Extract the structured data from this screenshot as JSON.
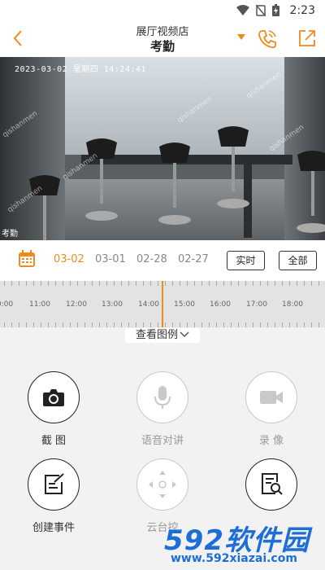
{
  "status_bar": {
    "time": "2:23"
  },
  "header": {
    "store_name": "展厅视频店",
    "camera_name": "考勤"
  },
  "video": {
    "osd_text": "2023-03-02 星期四 14:24:41",
    "watermark": "qishanmen",
    "camera_label": "考勤"
  },
  "date_bar": {
    "dates": [
      "03-02",
      "03-01",
      "02-28",
      "02-27"
    ],
    "selected_date": "03-02",
    "live_button": "实时",
    "all_button": "全部"
  },
  "timeline": {
    "labels": [
      "0:00",
      "11:00",
      "12:00",
      "13:00",
      "14:00",
      "15:00",
      "16:00",
      "17:00",
      "18:00"
    ]
  },
  "legend_label": "查看图例",
  "functions": [
    {
      "label": "截 图",
      "icon": "camera-icon",
      "enabled": true
    },
    {
      "label": "语音对讲",
      "icon": "microphone-icon",
      "enabled": false
    },
    {
      "label": "录 像",
      "icon": "video-record-icon",
      "enabled": false
    },
    {
      "label": "创建事件",
      "icon": "edit-icon",
      "enabled": true
    },
    {
      "label": "云台控",
      "icon": "ptz-control-icon",
      "enabled": false
    },
    {
      "label": "",
      "icon": "search-document-icon",
      "enabled": true
    }
  ],
  "watermark_logo": {
    "text": "592软件园",
    "url": "www.592xiazai.com"
  },
  "colors": {
    "accent": "#f08a1c",
    "logo_blue": "#1d6fd8"
  }
}
